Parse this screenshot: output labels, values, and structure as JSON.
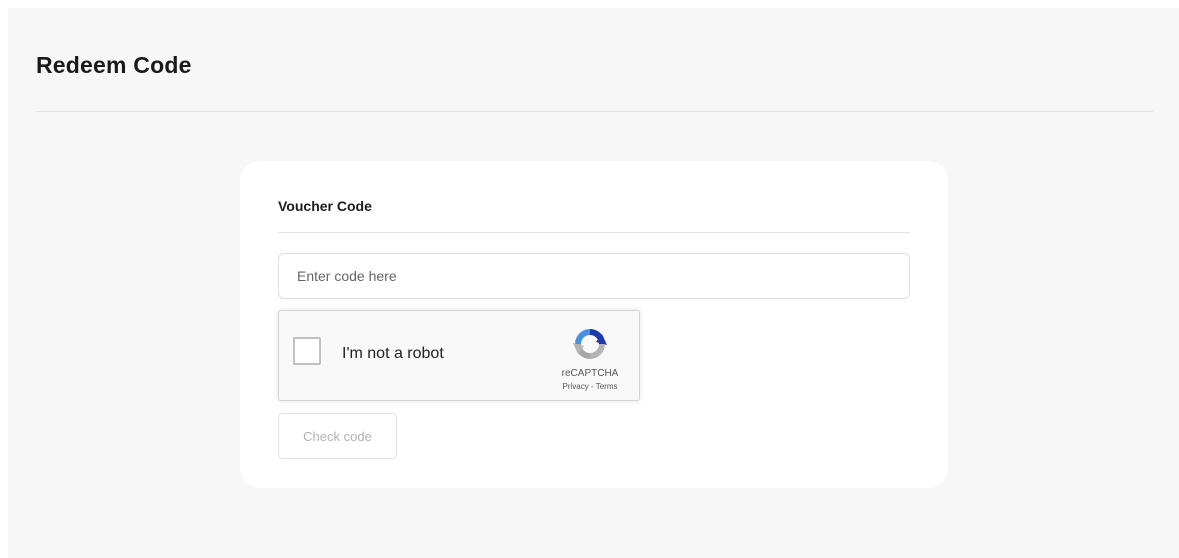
{
  "header": {
    "title": "Redeem Code"
  },
  "voucher_card": {
    "title": "Voucher Code",
    "input": {
      "placeholder": "Enter code here",
      "value": ""
    },
    "recaptcha": {
      "label": "I'm not a robot",
      "brand": "reCAPTCHA",
      "privacy_link": "Privacy",
      "separator": "-",
      "terms_link": "Terms",
      "checked": false,
      "logo_icon": "recaptcha-logo-icon"
    },
    "submit_button": {
      "label": "Check code",
      "disabled": true
    }
  },
  "colors": {
    "page_background": "#f7f7f7",
    "card_background": "#ffffff",
    "recaptcha_blue": "#4a90e2",
    "recaptcha_dark_blue": "#1c3aa9",
    "recaptcha_gray": "#b4b4b4",
    "disabled_text": "#b3b3b3"
  }
}
